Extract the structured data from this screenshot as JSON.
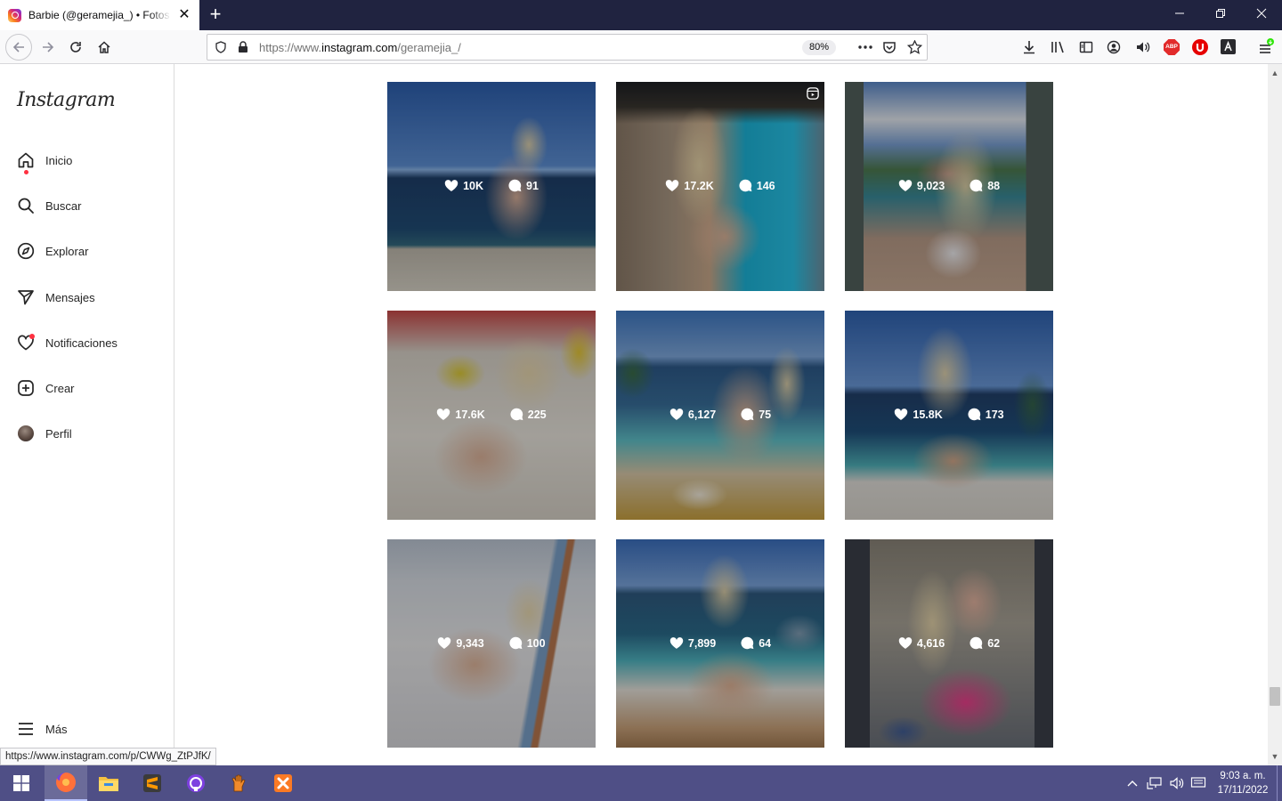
{
  "browser": {
    "tab_title": "Barbie (@geramejia_) • Fotos y videos",
    "tab_close": "✕",
    "new_tab": "+",
    "url_prefix": "https://www.",
    "url_domain": "instagram.com",
    "url_path": "/geramejia_/",
    "zoom": "80%",
    "status_url": "https://www.instagram.com/p/CWWg_ZtPJfK/"
  },
  "sidebar": {
    "logo": "Instagram",
    "items": [
      {
        "label": "Inicio",
        "icon": "home-icon",
        "notify": true
      },
      {
        "label": "Buscar",
        "icon": "search-icon"
      },
      {
        "label": "Explorar",
        "icon": "compass-icon"
      },
      {
        "label": "Mensajes",
        "icon": "send-icon"
      },
      {
        "label": "Notificaciones",
        "icon": "heart-icon",
        "notify": true
      },
      {
        "label": "Crear",
        "icon": "plus-square-icon"
      },
      {
        "label": "Perfil",
        "icon": "avatar"
      }
    ],
    "more": "Más"
  },
  "posts": [
    {
      "likes": "10K",
      "comments": "91",
      "is_reel": false
    },
    {
      "likes": "17.2K",
      "comments": "146",
      "is_reel": true
    },
    {
      "likes": "9,023",
      "comments": "88",
      "is_reel": false
    },
    {
      "likes": "17.6K",
      "comments": "225",
      "is_reel": false
    },
    {
      "likes": "6,127",
      "comments": "75",
      "is_reel": false
    },
    {
      "likes": "15.8K",
      "comments": "173",
      "is_reel": false
    },
    {
      "likes": "9,343",
      "comments": "100",
      "is_reel": false
    },
    {
      "likes": "7,899",
      "comments": "64",
      "is_reel": false
    },
    {
      "likes": "4,616",
      "comments": "62",
      "is_reel": false
    }
  ],
  "taskbar": {
    "clock_time": "9:03 a. m.",
    "clock_date": "17/11/2022"
  },
  "colors": {
    "titlebar": "#202340",
    "taskbar": "#4f4f86",
    "notify_dot": "#ff3040"
  }
}
